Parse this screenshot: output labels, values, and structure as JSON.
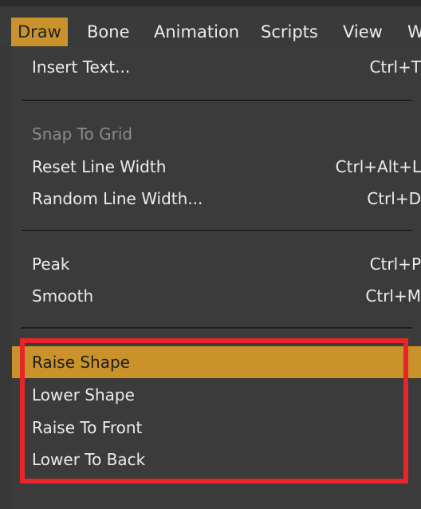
{
  "menubar": {
    "items": [
      "Draw",
      "Bone",
      "Animation",
      "Scripts",
      "View",
      "W"
    ]
  },
  "dropdown": {
    "insert_text": {
      "label": "Insert Text...",
      "shortcut": "Ctrl+T"
    },
    "snap_to_grid": {
      "label": "Snap To Grid"
    },
    "reset_line_width": {
      "label": "Reset Line Width",
      "shortcut": "Ctrl+Alt+L"
    },
    "random_line_width": {
      "label": "Random Line Width...",
      "shortcut": "Ctrl+D"
    },
    "peak": {
      "label": "Peak",
      "shortcut": "Ctrl+P"
    },
    "smooth": {
      "label": "Smooth",
      "shortcut": "Ctrl+M"
    },
    "raise_shape": {
      "label": "Raise Shape"
    },
    "lower_shape": {
      "label": "Lower Shape"
    },
    "raise_to_front": {
      "label": "Raise To Front"
    },
    "lower_to_back": {
      "label": "Lower To Back"
    }
  },
  "colors": {
    "accent": "#c9922a",
    "highlight_box": "#e8262a",
    "menu_bg": "#3b3b3b"
  }
}
